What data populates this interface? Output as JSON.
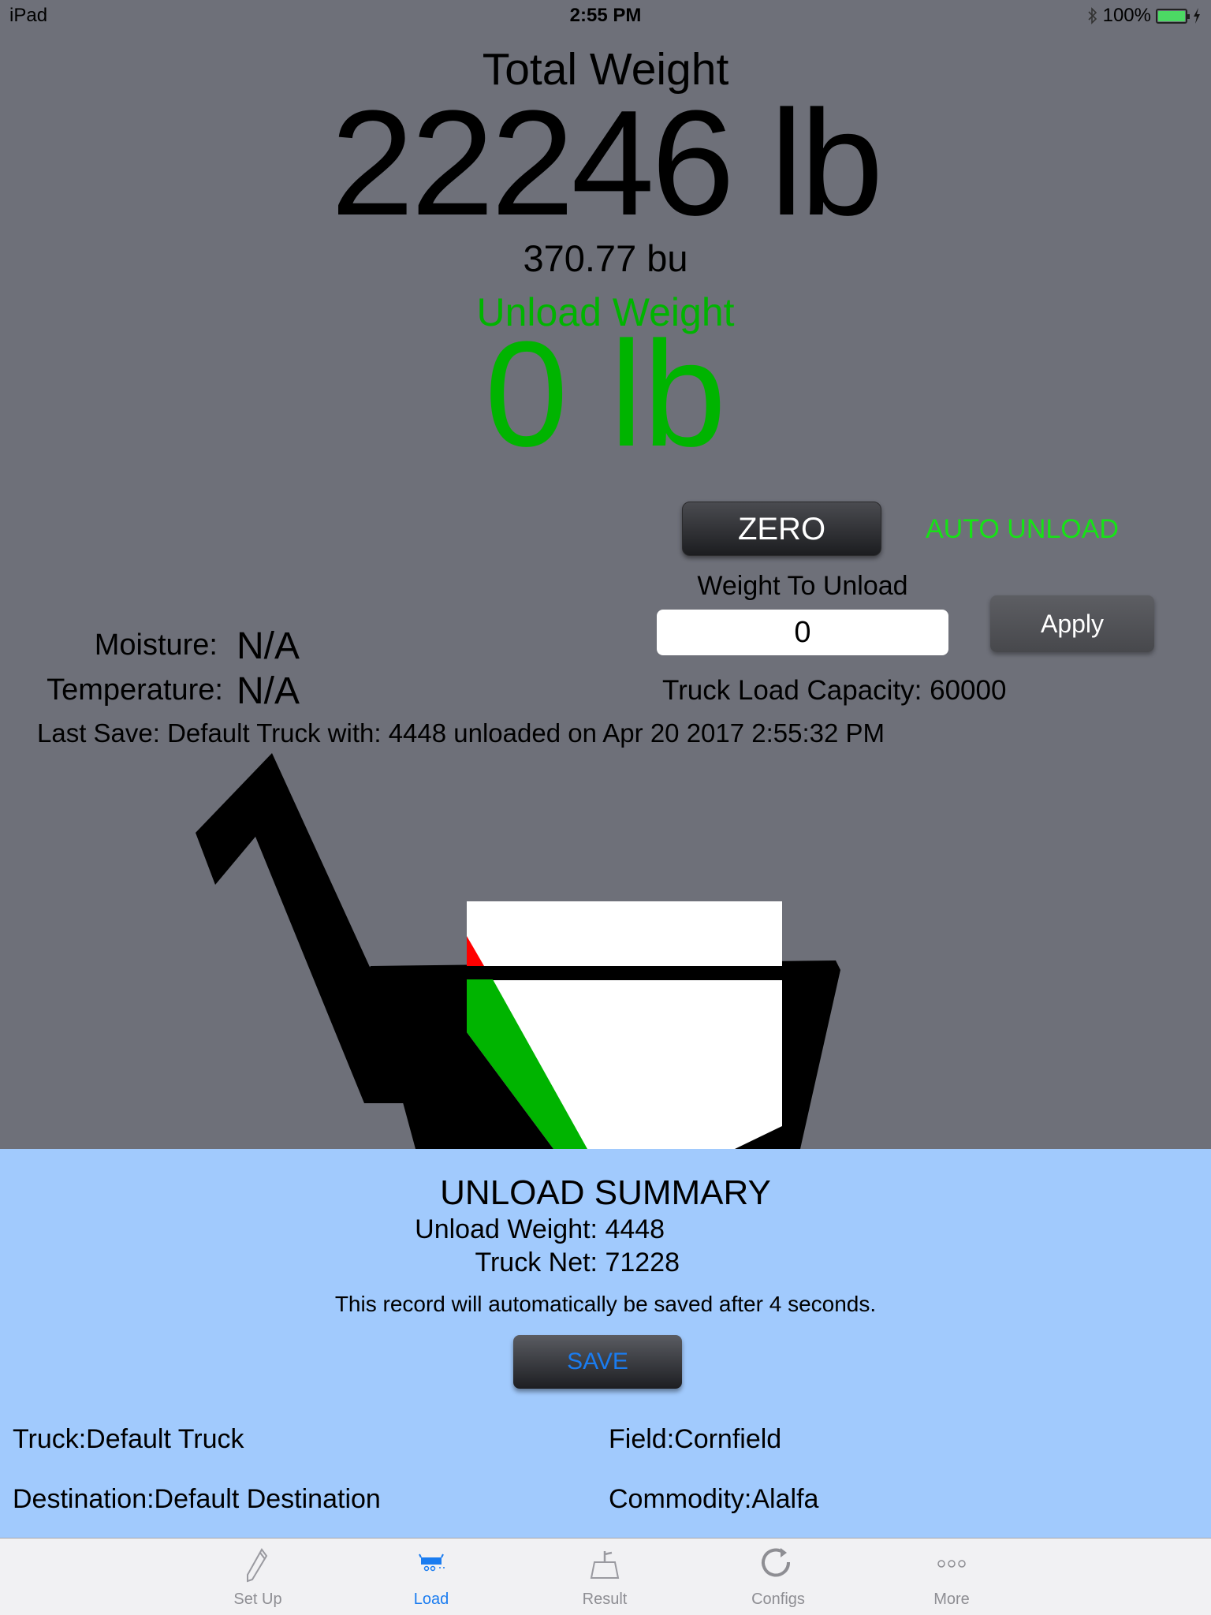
{
  "status_bar": {
    "device": "iPad",
    "time": "2:55 PM",
    "battery_percent": "100%",
    "bluetooth_icon": "bluetooth-icon",
    "battery_icon": "battery-charging-icon",
    "battery_fill": 1.0
  },
  "weights": {
    "total_label": "Total Weight",
    "total_value": "22246 lb",
    "bushels": "370.77 bu",
    "unload_label": "Unload Weight",
    "unload_value": "0 lb"
  },
  "controls": {
    "zero_label": "ZERO",
    "auto_unload_label": "AUTO UNLOAD",
    "weight_to_unload_label": "Weight To Unload",
    "weight_to_unload_value": "0",
    "apply_label": "Apply",
    "truck_capacity": "Truck Load Capacity: 60000"
  },
  "sensors": {
    "moisture_label": "Moisture:",
    "moisture_value": "N/A",
    "temperature_label": "Temperature:",
    "temperature_value": "N/A"
  },
  "last_save": "Last Save: Default Truck with: 4448 unloaded on Apr 20 2017 2:55:32 PM",
  "colors": {
    "background": "#6e7079",
    "unload_green": "#00b400",
    "auto_unload_green": "#16e316",
    "summary_bg": "#a1cafd",
    "tab_active": "#1a7cf0",
    "truck_fill_green": "#00b400",
    "truck_overflow_red": "#ff0000"
  },
  "summary": {
    "title": "UNLOAD SUMMARY",
    "unload_weight_label": "Unload Weight:",
    "unload_weight_value": "4448",
    "truck_net_label": "Truck Net:",
    "truck_net_value": "71228",
    "autosave_message": "This record will automatically be saved after 4 seconds.",
    "save_label": "SAVE",
    "truck": "Truck:Default Truck",
    "field": "Field:Cornfield",
    "destination": "Destination:Default Destination",
    "commodity": "Commodity:Alalfa"
  },
  "tabs": [
    {
      "label": "Set Up",
      "icon": "pencil-icon",
      "active": false
    },
    {
      "label": "Load",
      "icon": "load-truck-icon",
      "active": true
    },
    {
      "label": "Result",
      "icon": "scale-icon",
      "active": false
    },
    {
      "label": "Configs",
      "icon": "refresh-icon",
      "active": false
    },
    {
      "label": "More",
      "icon": "more-icon",
      "active": false
    }
  ]
}
